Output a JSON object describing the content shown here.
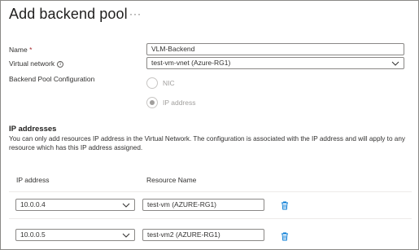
{
  "header": {
    "title": "Add backend pool",
    "more_label": "···"
  },
  "form": {
    "name_label": "Name",
    "name_required": "*",
    "name_value": "VLM-Backend",
    "vnet_label": "Virtual network",
    "vnet_info_icon": "i",
    "vnet_value": "test-vm-vnet (Azure-RG1)",
    "pool_config_label": "Backend Pool Configuration",
    "options": [
      {
        "label": "NIC",
        "selected": false
      },
      {
        "label": "IP address",
        "selected": true
      }
    ]
  },
  "ip_section": {
    "heading": "IP addresses",
    "description": "You can only add resources IP address in the Virtual Network. The configuration is associated with the IP address and will apply to any resource which has this IP address assigned.",
    "columns": [
      "IP address",
      "Resource Name"
    ],
    "rows": [
      {
        "ip": "10.0.0.4",
        "resource": "test-vm (AZURE-RG1)"
      },
      {
        "ip": "10.0.0.5",
        "resource": "test-vm2 (AZURE-RG1)"
      }
    ]
  },
  "colors": {
    "accent": "#0078d4",
    "border": "#8a8886",
    "disabled": "#a19f9d"
  },
  "icons": {
    "more": "ellipsis-icon",
    "dropdown": "chevron-down-icon",
    "delete": "trash-icon",
    "info": "info-icon"
  }
}
